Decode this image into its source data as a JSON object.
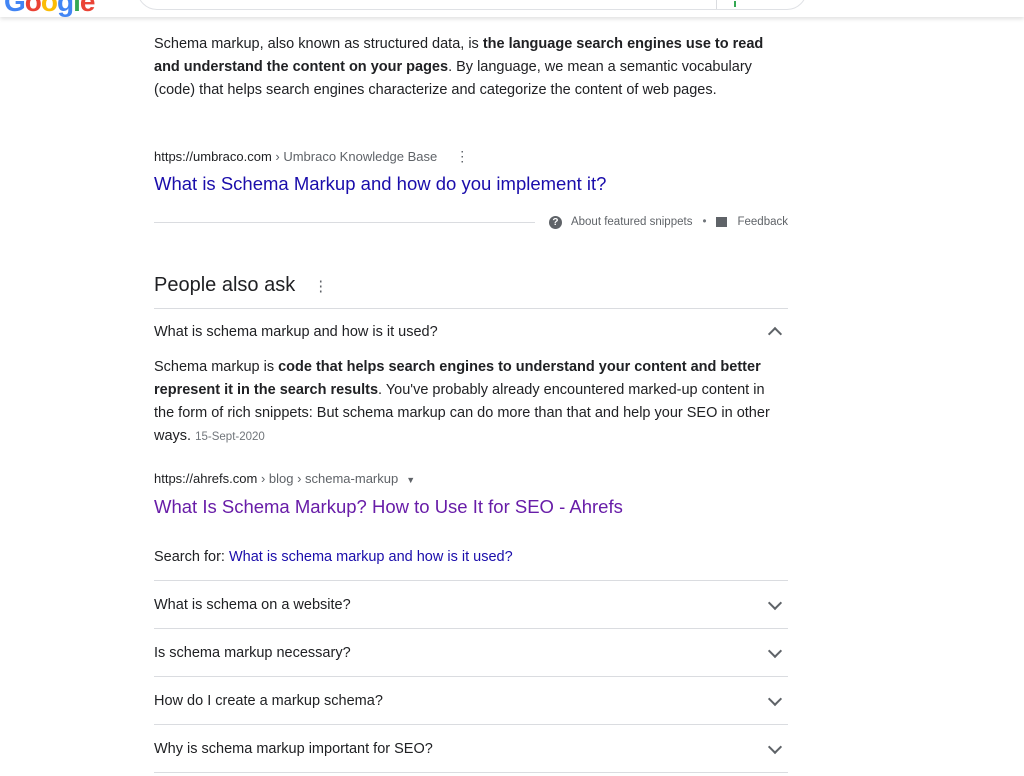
{
  "header": {
    "logo": "Google"
  },
  "snippet": {
    "pre": "Schema markup, also known as structured data, is ",
    "bold": "the language search engines use to read and understand the content on your pages",
    "post": ". By language, we mean a semantic vocabulary (code) that helps search engines characterize and categorize the content of web pages.",
    "cite_domain": "https://umbraco.com",
    "cite_path": " › Umbraco Knowledge Base",
    "title": "What is Schema Markup and how do you implement it?",
    "about": "About featured snippets",
    "sep": "•",
    "feedback": "Feedback"
  },
  "paa": {
    "heading": "People also ask",
    "expanded": {
      "question": "What is schema markup and how is it used?",
      "pre": "Schema markup is ",
      "bold": "code that helps search engines to understand your content and better represent it in the search results",
      "post": ". You've probably already encountered marked-up content in the form of rich snippets: But schema markup can do more than that and help your SEO in other ways.",
      "date": "15-Sept-2020",
      "cite_domain": "https://ahrefs.com",
      "cite_path": " › blog › schema-markup",
      "title": "What Is Schema Markup? How to Use It for SEO - Ahrefs",
      "search_for_label": "Search for: ",
      "search_for_link": "What is schema markup and how is it used?"
    },
    "questions": [
      "What is schema on a website?",
      "Is schema markup necessary?",
      "How do I create a markup schema?",
      "Why is schema markup important for SEO?"
    ]
  }
}
